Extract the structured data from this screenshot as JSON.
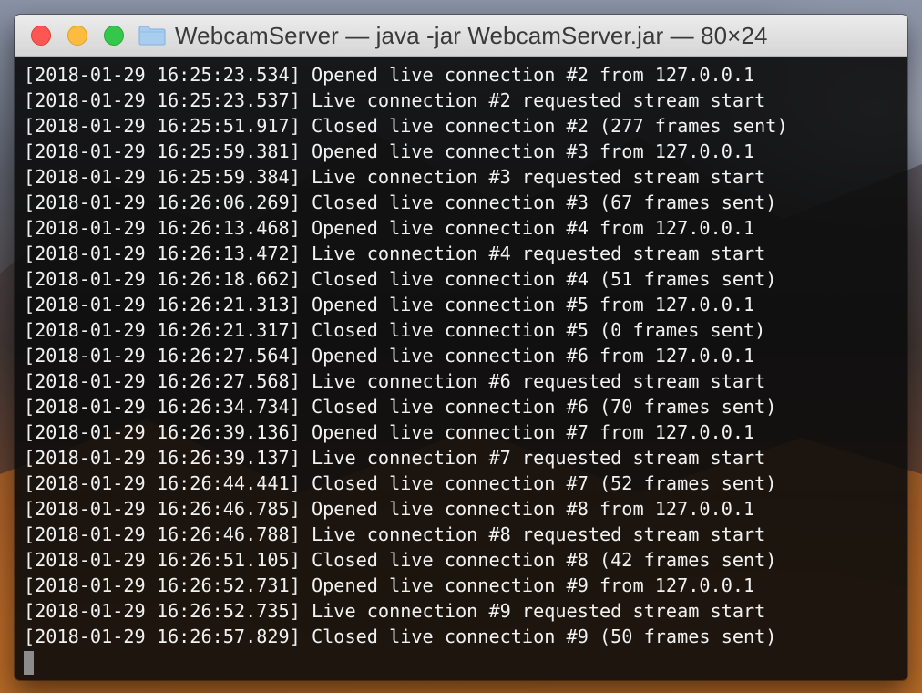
{
  "window": {
    "title": "WebcamServer — java -jar WebcamServer.jar — 80×24",
    "title_icon": "folder-icon"
  },
  "colors": {
    "close": "#fc5753",
    "minimize": "#fdbc40",
    "zoom": "#34c84a",
    "terminal_text": "#f2f2f2",
    "terminal_bg": "#0c0c0c"
  },
  "terminal": {
    "lines": [
      "[2018-01-29 16:25:23.534] Opened live connection #2 from 127.0.0.1",
      "[2018-01-29 16:25:23.537] Live connection #2 requested stream start",
      "[2018-01-29 16:25:51.917] Closed live connection #2 (277 frames sent)",
      "[2018-01-29 16:25:59.381] Opened live connection #3 from 127.0.0.1",
      "[2018-01-29 16:25:59.384] Live connection #3 requested stream start",
      "[2018-01-29 16:26:06.269] Closed live connection #3 (67 frames sent)",
      "[2018-01-29 16:26:13.468] Opened live connection #4 from 127.0.0.1",
      "[2018-01-29 16:26:13.472] Live connection #4 requested stream start",
      "[2018-01-29 16:26:18.662] Closed live connection #4 (51 frames sent)",
      "[2018-01-29 16:26:21.313] Opened live connection #5 from 127.0.0.1",
      "[2018-01-29 16:26:21.317] Closed live connection #5 (0 frames sent)",
      "[2018-01-29 16:26:27.564] Opened live connection #6 from 127.0.0.1",
      "[2018-01-29 16:26:27.568] Live connection #6 requested stream start",
      "[2018-01-29 16:26:34.734] Closed live connection #6 (70 frames sent)",
      "[2018-01-29 16:26:39.136] Opened live connection #7 from 127.0.0.1",
      "[2018-01-29 16:26:39.137] Live connection #7 requested stream start",
      "[2018-01-29 16:26:44.441] Closed live connection #7 (52 frames sent)",
      "[2018-01-29 16:26:46.785] Opened live connection #8 from 127.0.0.1",
      "[2018-01-29 16:26:46.788] Live connection #8 requested stream start",
      "[2018-01-29 16:26:51.105] Closed live connection #8 (42 frames sent)",
      "[2018-01-29 16:26:52.731] Opened live connection #9 from 127.0.0.1",
      "[2018-01-29 16:26:52.735] Live connection #9 requested stream start",
      "[2018-01-29 16:26:57.829] Closed live connection #9 (50 frames sent)"
    ]
  }
}
